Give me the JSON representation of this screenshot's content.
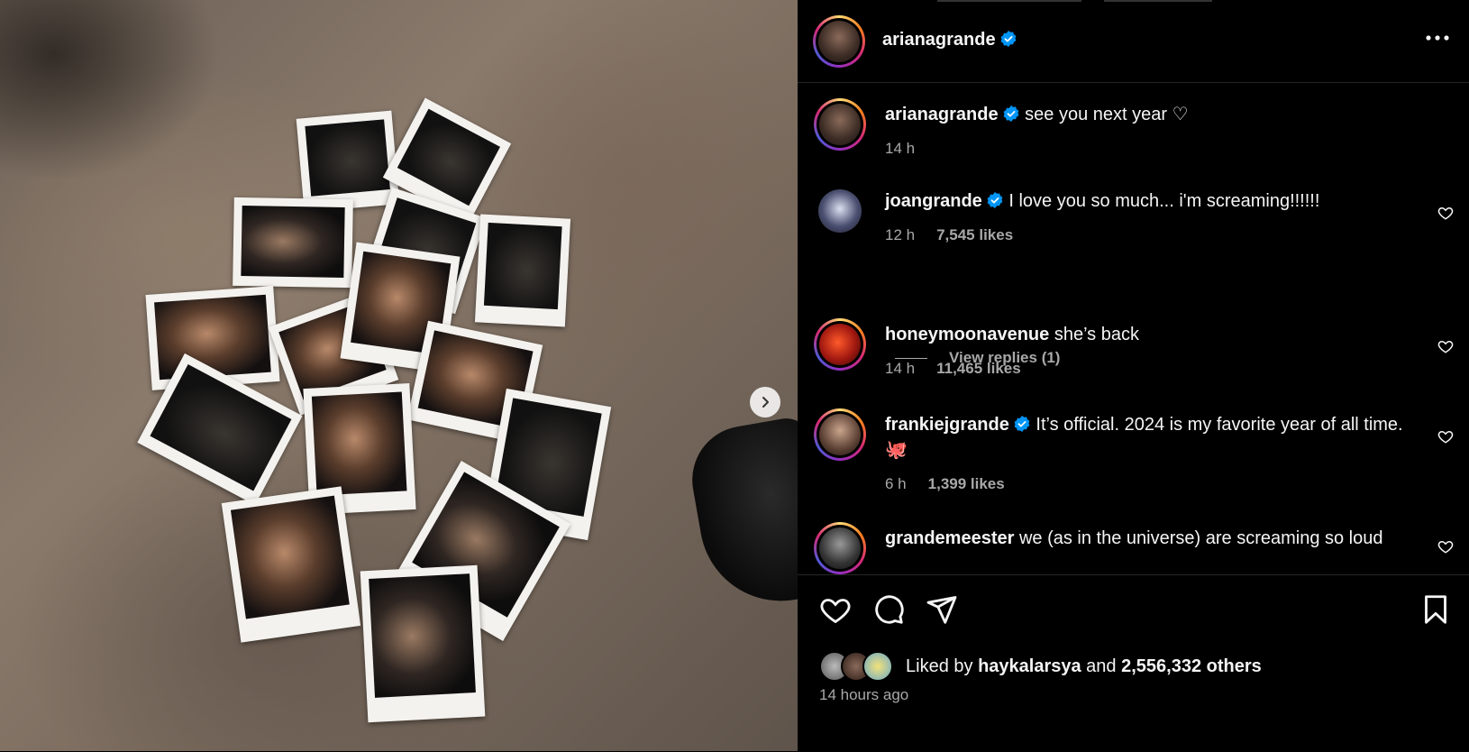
{
  "post": {
    "username": "arianagrande",
    "verified": true
  },
  "caption": {
    "username": "arianagrande",
    "text": "see you next year ♡",
    "time": "14 h"
  },
  "comments": [
    {
      "username": "joangrande",
      "verified": true,
      "text": "I love you so much... i'm screaming!!!!!!",
      "time": "12 h",
      "likes": "7,545 likes",
      "replies": "View replies (1)"
    },
    {
      "username": "honeymoonavenue",
      "verified": false,
      "text": "she’s back",
      "time": "14 h",
      "likes": "11,465 likes"
    },
    {
      "username": "frankiejgrande",
      "verified": true,
      "text": "It’s official. 2024 is my favorite year of all time. 🐙",
      "time": "6 h",
      "likes": "1,399 likes"
    },
    {
      "username": "grandemeester",
      "verified": false,
      "text": "we (as in the universe) are screaming so loud"
    }
  ],
  "likes_summary": {
    "prefix": "Liked by",
    "user": "haykalarsya",
    "joiner": "and",
    "others": "2,556,332 others"
  },
  "posted_ago": "14 hours ago",
  "icons": [
    "verified-badge-icon",
    "more-options-icon",
    "heart-icon",
    "comment-icon",
    "share-icon",
    "bookmark-icon",
    "chevron-right-icon"
  ],
  "colors": {
    "verified": "#0095f6",
    "background": "#000000",
    "secondary_text": "#a8a8a8"
  }
}
